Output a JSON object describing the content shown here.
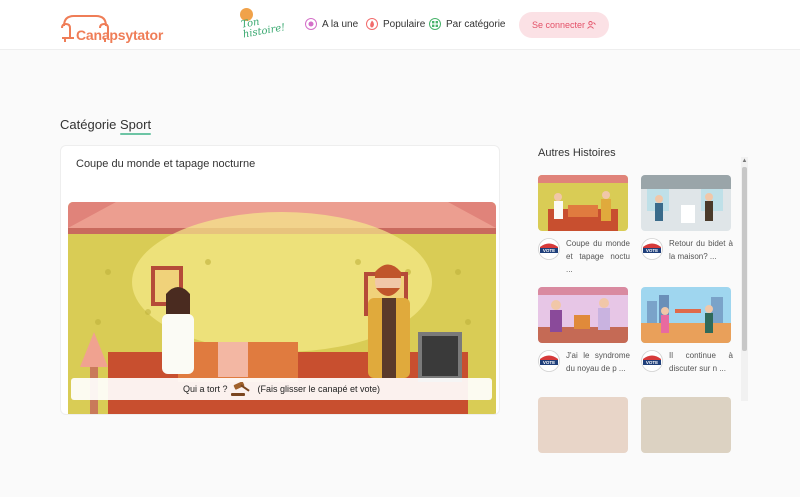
{
  "header": {
    "logo_text": "Canapsytator",
    "badge_text": "Ton\nhistoire!",
    "nav": [
      {
        "label": "A la une",
        "icon": "star-icon",
        "color": "#d46fc8"
      },
      {
        "label": "Populaire",
        "icon": "flame-icon",
        "color": "#f26b6b"
      },
      {
        "label": "Par catégorie",
        "icon": "category-icon",
        "color": "#48b36a"
      }
    ],
    "login_label": "Se connecter",
    "colors": {
      "brand": "#ef7d57",
      "login_bg": "#fbe1e5",
      "login_text": "#e35168",
      "accent_underline": "#6cc4a4"
    }
  },
  "category": {
    "prefix": "Catégorie",
    "name": "Sport"
  },
  "main_story": {
    "title": "Coupe du monde et tapage nocturne",
    "vote_prefix": "Qui a tort ?",
    "vote_suffix": "(Fais glisser le canapé et vote)"
  },
  "sidebar": {
    "title": "Autres Histoires",
    "vote_label": "VOTE",
    "stories": [
      {
        "text": "Coupe du monde et tapage noctu ..."
      },
      {
        "text": "Retour du bidet à la maison? ..."
      },
      {
        "text": "J'ai le syndrome du noyau de p ..."
      },
      {
        "text": "Il continue à discuter sur n ..."
      }
    ]
  }
}
